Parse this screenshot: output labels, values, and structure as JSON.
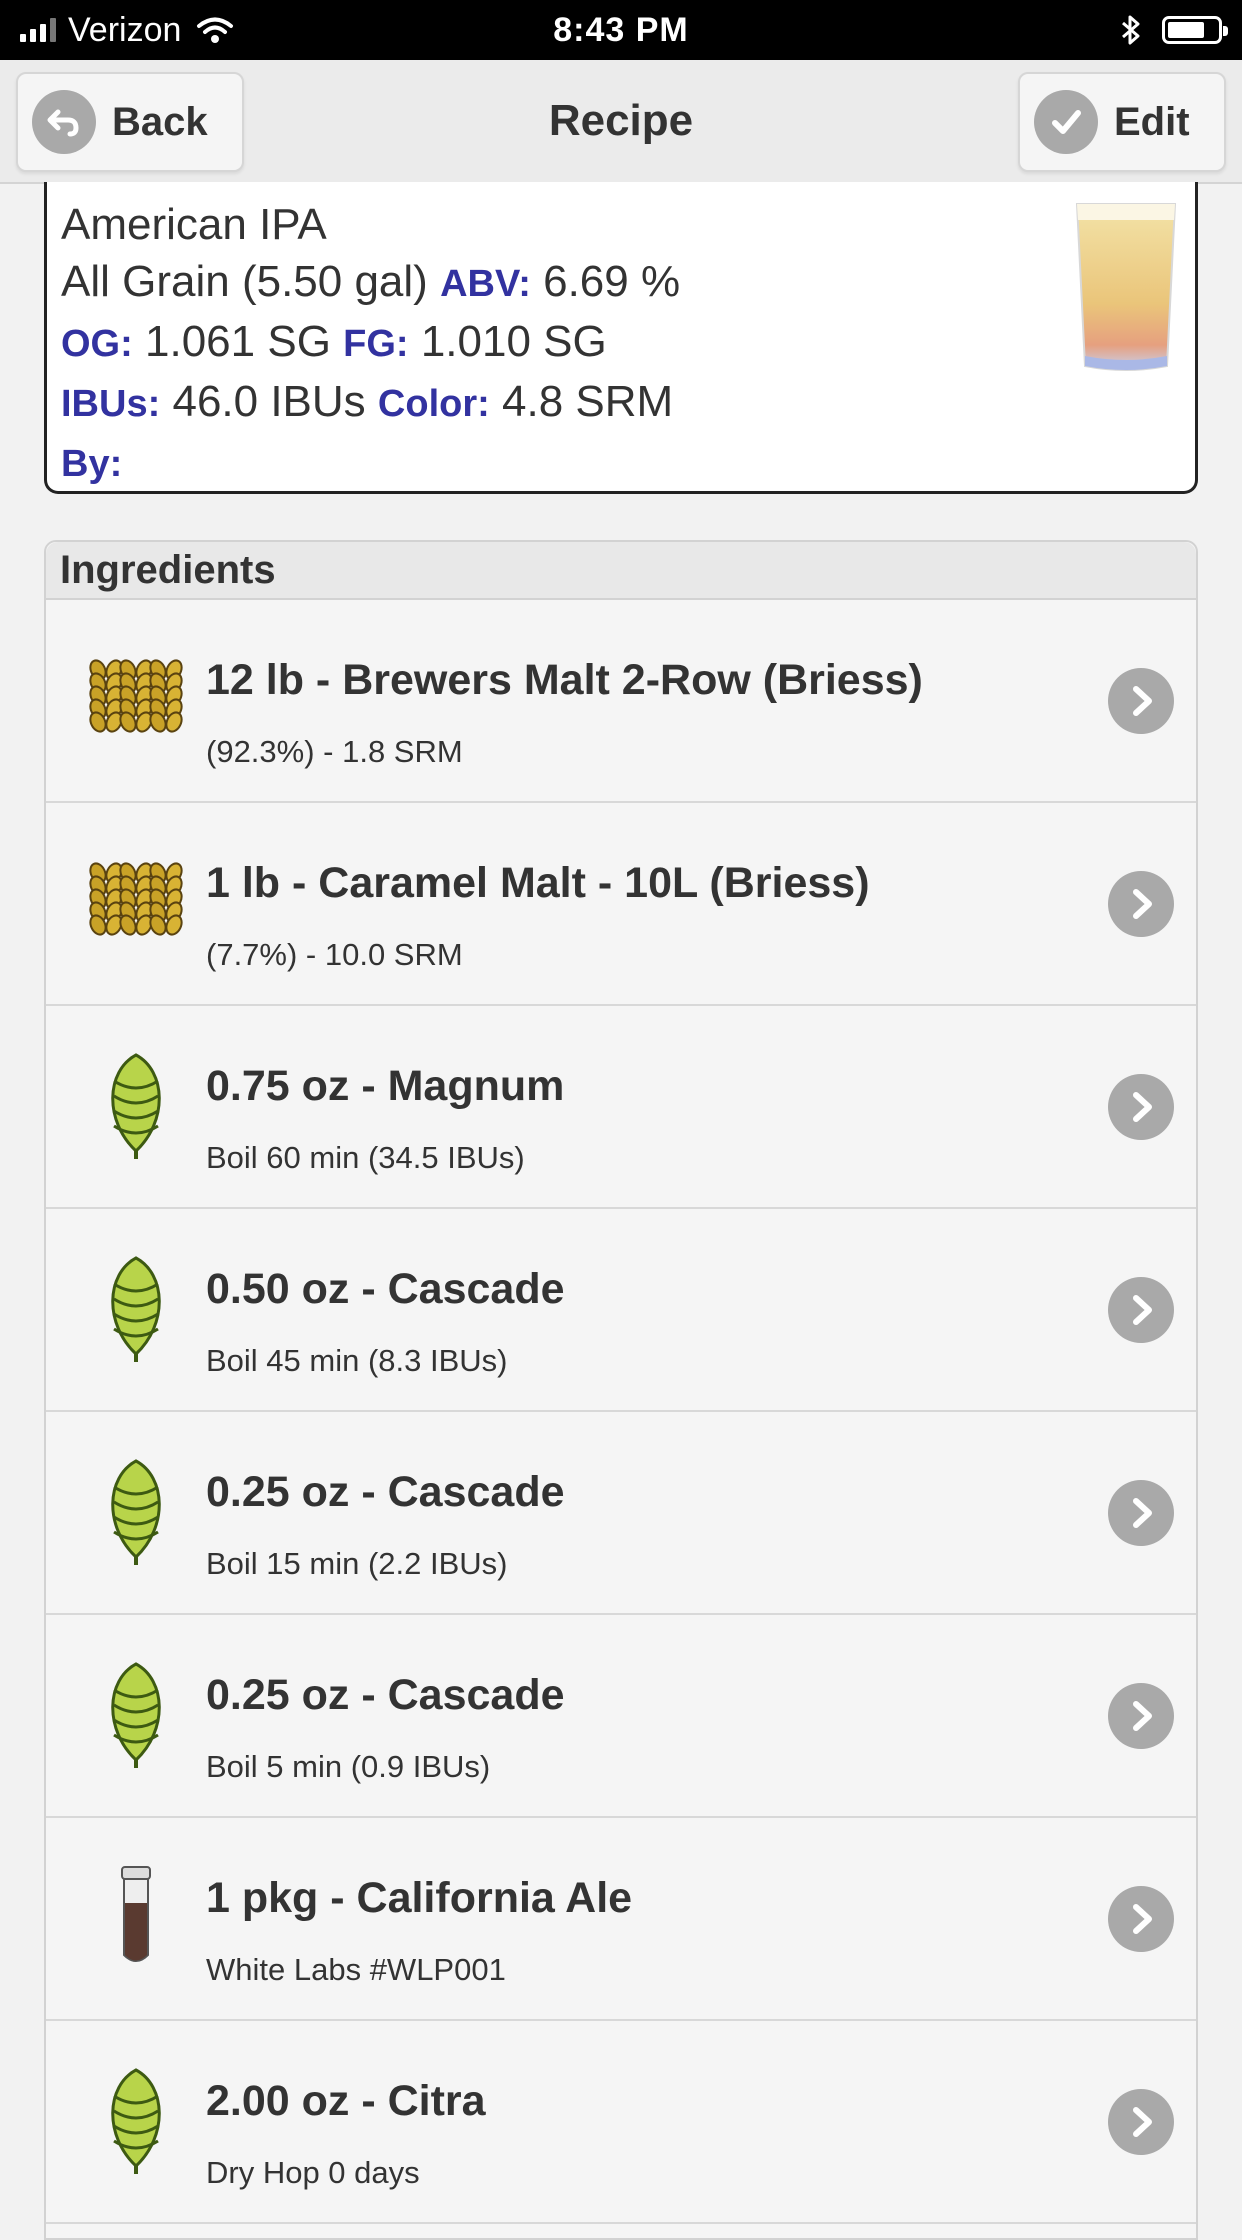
{
  "status_bar": {
    "carrier": "Verizon",
    "time": "8:43 PM"
  },
  "nav": {
    "back_label": "Back",
    "title": "Recipe",
    "edit_label": "Edit"
  },
  "summary": {
    "style": "American IPA",
    "type": "All Grain (5.50 gal)",
    "abv_label": "ABV:",
    "abv": "6.69 %",
    "og_label": "OG:",
    "og": "1.061 SG",
    "fg_label": "FG:",
    "fg": "1.010 SG",
    "ibu_label": "IBUs:",
    "ibu": "46.0 IBUs",
    "color_label": "Color:",
    "color": "4.8 SRM",
    "by_label": "By:"
  },
  "ingredients": {
    "header": "Ingredients",
    "items": [
      {
        "icon": "grain-icon",
        "title": "12 lb - Brewers Malt 2-Row (Briess)",
        "subtitle": "(92.3%) - 1.8 SRM"
      },
      {
        "icon": "grain-icon",
        "title": "1 lb - Caramel Malt - 10L (Briess)",
        "subtitle": "(7.7%) - 10.0 SRM"
      },
      {
        "icon": "hop-icon",
        "title": "0.75 oz - Magnum",
        "subtitle": "Boil 60 min (34.5 IBUs)"
      },
      {
        "icon": "hop-icon",
        "title": "0.50 oz - Cascade",
        "subtitle": "Boil 45 min (8.3 IBUs)"
      },
      {
        "icon": "hop-icon",
        "title": "0.25 oz - Cascade",
        "subtitle": "Boil 15 min (2.2 IBUs)"
      },
      {
        "icon": "hop-icon",
        "title": "0.25 oz - Cascade",
        "subtitle": "Boil 5 min (0.9 IBUs)"
      },
      {
        "icon": "yeast-vial-icon",
        "title": "1 pkg - California Ale",
        "subtitle": "White Labs #WLP001"
      },
      {
        "icon": "hop-icon",
        "title": "2.00 oz - Citra",
        "subtitle": "Dry Hop 0 days"
      }
    ]
  },
  "colors": {
    "label_blue": "#3232a0",
    "chevron_gray": "#a9a9a9",
    "hop_green": "#9cc43a",
    "grain_gold": "#c9a227"
  }
}
